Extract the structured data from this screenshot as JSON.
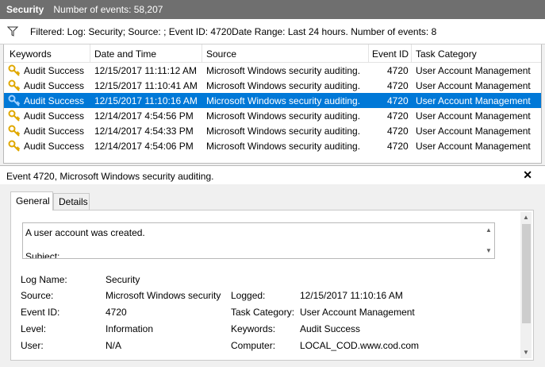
{
  "titlebar": {
    "title": "Security",
    "count": "Number of events: 58,207"
  },
  "filter": {
    "icon": "filter-icon",
    "text": "Filtered: Log: Security; Source: ; Event ID: 4720Date Range: Last 24 hours. Number of events: 8"
  },
  "grid": {
    "columns": [
      "Keywords",
      "Date and Time",
      "Source",
      "Event ID",
      "Task Category"
    ],
    "rows": [
      [
        "Audit Success",
        "12/15/2017 11:11:12 AM",
        "Microsoft Windows security auditing.",
        "4720",
        "User Account Management"
      ],
      [
        "Audit Success",
        "12/15/2017 11:10:41 AM",
        "Microsoft Windows security auditing.",
        "4720",
        "User Account Management"
      ],
      [
        "Audit Success",
        "12/15/2017 11:10:16 AM",
        "Microsoft Windows security auditing.",
        "4720",
        "User Account Management"
      ],
      [
        "Audit Success",
        "12/14/2017 4:54:56 PM",
        "Microsoft Windows security auditing.",
        "4720",
        "User Account Management"
      ],
      [
        "Audit Success",
        "12/14/2017 4:54:33 PM",
        "Microsoft Windows security auditing.",
        "4720",
        "User Account Management"
      ],
      [
        "Audit Success",
        "12/14/2017 4:54:06 PM",
        "Microsoft Windows security auditing.",
        "4720",
        "User Account Management"
      ]
    ],
    "selected_row_index": 2,
    "selection_color": "#0078d7"
  },
  "detail": {
    "title": "Event 4720, Microsoft Windows security auditing.",
    "close": "✕",
    "tabs": [
      "General",
      "Details"
    ],
    "active_tab": "General",
    "description_lines": [
      "A user account was created.",
      "Subject:"
    ],
    "fields": {
      "log_name_label": "Log Name:",
      "log_name": "Security",
      "source_label": "Source:",
      "source": "Microsoft Windows security",
      "logged_label": "Logged:",
      "logged": "12/15/2017 11:10:16 AM",
      "event_id_label": "Event ID:",
      "event_id": "4720",
      "task_category_label": "Task Category:",
      "task_category": "User Account Management",
      "level_label": "Level:",
      "level": "Information",
      "keywords_label": "Keywords:",
      "keywords": "Audit Success",
      "user_label": "User:",
      "user": "N/A",
      "computer_label": "Computer:",
      "computer": "LOCAL_COD.www.cod.com"
    }
  }
}
